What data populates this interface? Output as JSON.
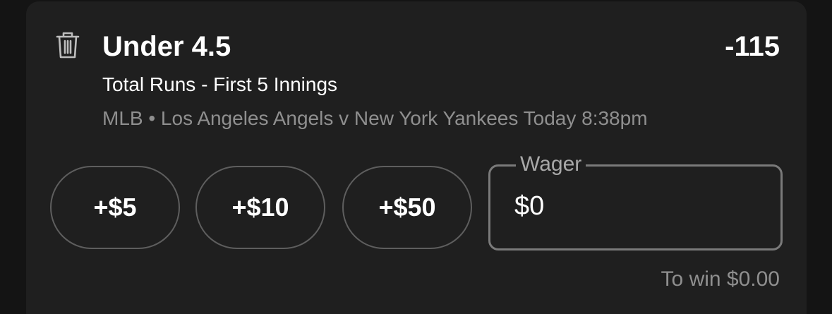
{
  "bet": {
    "selection": "Under 4.5",
    "odds": "-115",
    "market": "Total Runs - First 5 Innings",
    "event": "MLB • Los Angeles Angels v New York Yankees Today 8:38pm"
  },
  "quick_add": [
    {
      "label": "+$5"
    },
    {
      "label": "+$10"
    },
    {
      "label": "+$50"
    }
  ],
  "wager": {
    "label": "Wager",
    "value": "$0"
  },
  "payout": {
    "to_win": "To win $0.00"
  },
  "icons": {
    "remove": "trash-icon"
  },
  "colors": {
    "card_background": "#1f1f1f",
    "page_background": "#141414",
    "muted_text": "#8f8f8f"
  }
}
